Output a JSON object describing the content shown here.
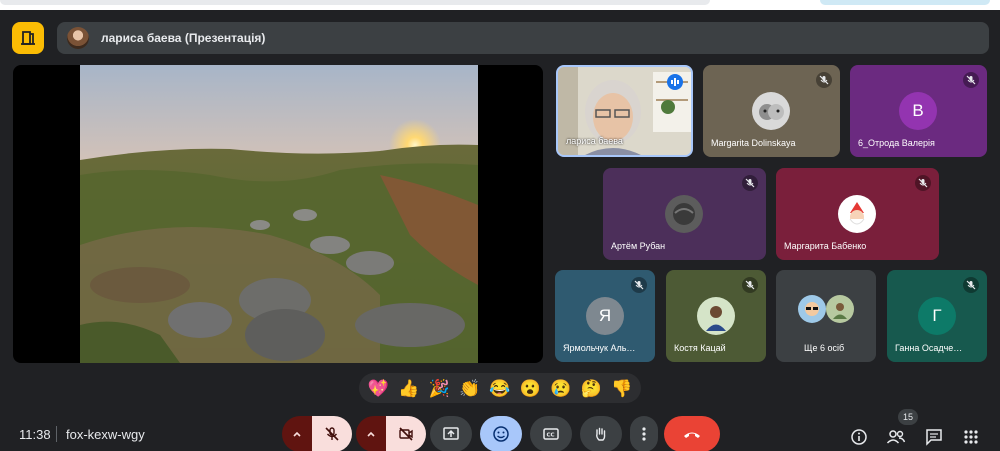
{
  "header": {
    "presenter_label": "лариса баева (Презентація)"
  },
  "tiles": [
    {
      "name": "лариса баева",
      "kind": "video",
      "muted": false
    },
    {
      "name": "Margarita Dolinskaya",
      "kind": "avatar",
      "muted": true
    },
    {
      "name": "6_Отрода Валерія",
      "kind": "letter",
      "letter": "В",
      "muted": true
    },
    {
      "name": "Артём Рубан",
      "kind": "avatar",
      "muted": true
    },
    {
      "name": "Маргарита Бабенко",
      "kind": "avatar",
      "muted": true
    },
    {
      "name": "Ярмольчук Аль…",
      "kind": "letter",
      "letter": "Я",
      "muted": true
    },
    {
      "name": "Костя Кацай",
      "kind": "avatar",
      "muted": true
    },
    {
      "name": "Ще 6 осіб",
      "kind": "group",
      "muted": false
    },
    {
      "name": "Ганна Осадче…",
      "kind": "letter",
      "letter": "Г",
      "muted": true
    }
  ],
  "reactions": [
    "💖",
    "👍",
    "🎉",
    "👏",
    "😂",
    "😮",
    "😢",
    "🤔",
    "👎"
  ],
  "footer": {
    "time": "11:38",
    "meeting_code": "fox-kexw-wgy",
    "participant_count": "15"
  },
  "colors": {
    "background": "#202124",
    "present_accent": "#fbbc04",
    "hangup": "#ea4335",
    "mic_off_bg": "#f9dedc",
    "caret_bg": "#601410",
    "reaction_active": "#a8c7fa"
  }
}
